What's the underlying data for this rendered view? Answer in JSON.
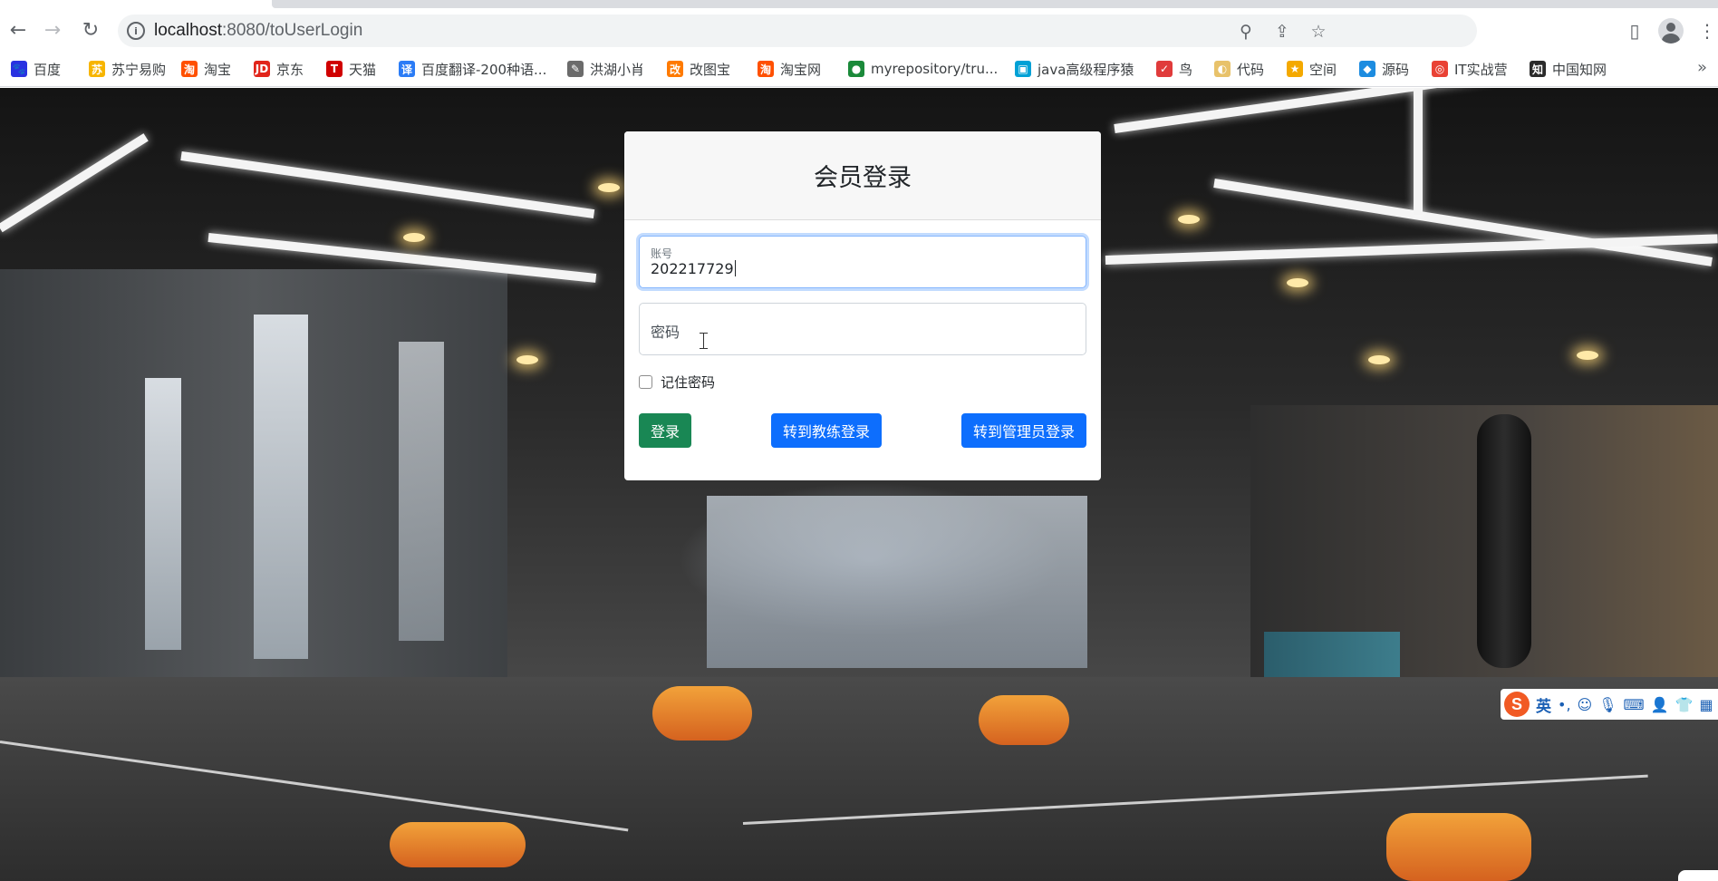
{
  "browser": {
    "url_host": "localhost",
    "url_rest": ":8080/toUserLogin",
    "back_icon": "arrow-left-icon",
    "forward_icon": "arrow-right-icon",
    "reload_icon": "reload-icon"
  },
  "bookmarks": [
    {
      "label": "百度",
      "color": "#2932e1",
      "glyph": "🐾"
    },
    {
      "label": "苏宁易购",
      "color": "#f7b500",
      "glyph": "苏"
    },
    {
      "label": "淘宝",
      "color": "#ff5000",
      "glyph": "淘"
    },
    {
      "label": "京东",
      "color": "#e1251b",
      "glyph": "JD"
    },
    {
      "label": "天猫",
      "color": "#d00000",
      "glyph": "T"
    },
    {
      "label": "百度翻译-200种语...",
      "color": "#2b7cf6",
      "glyph": "译"
    },
    {
      "label": "洪湖小肖",
      "color": "#6b6b6b",
      "glyph": "✎"
    },
    {
      "label": "改图宝",
      "color": "#ff7a00",
      "glyph": "改"
    },
    {
      "label": "淘宝网",
      "color": "#ff5000",
      "glyph": "淘"
    },
    {
      "label": "myrepository/tru...",
      "color": "#1b8a3a",
      "glyph": "●"
    },
    {
      "label": "java高级程序猿",
      "color": "#00a1d6",
      "glyph": "▣"
    },
    {
      "label": "鸟",
      "color": "#e03b3b",
      "glyph": "✓"
    },
    {
      "label": "代码",
      "color": "#e8c26a",
      "glyph": "◐"
    },
    {
      "label": "空间",
      "color": "#f4a900",
      "glyph": "★"
    },
    {
      "label": "源码",
      "color": "#1d8ce0",
      "glyph": "◆"
    },
    {
      "label": "IT实战营",
      "color": "#e94235",
      "glyph": "◎"
    },
    {
      "label": "中国知网",
      "color": "#2b2b2b",
      "glyph": "知"
    }
  ],
  "login": {
    "title": "会员登录",
    "account_label": "账号",
    "account_value": "202217729",
    "password_label": "密码",
    "remember_label": "记住密码",
    "login_button": "登录",
    "coach_button": "转到教练登录",
    "admin_button": "转到管理员登录"
  },
  "ime": {
    "logo": "S",
    "mode": "英"
  },
  "colors": {
    "success": "#198754",
    "primary": "#0d6efd",
    "focus_border": "#86b7fe"
  }
}
